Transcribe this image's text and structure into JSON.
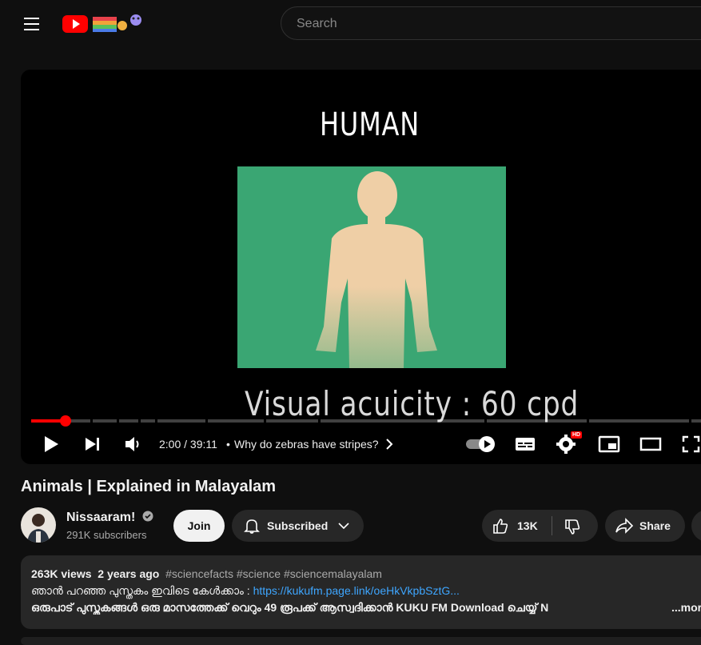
{
  "search": {
    "placeholder": "Search"
  },
  "player": {
    "frame_title": "HUMAN",
    "frame_caption": "Visual acuicity : 60 cpd",
    "time": "2:00 / 39:11",
    "chapter": "Why do zebras have stripes?",
    "progress_fraction": 0.051,
    "hd_badge": "HD"
  },
  "video": {
    "title": "Animals | Explained in Malayalam"
  },
  "owner": {
    "channel_name": "Nissaaram!",
    "subscribers": "291K subscribers",
    "join_label": "Join",
    "subscribed_label": "Subscribed"
  },
  "actions": {
    "like_count": "13K",
    "share_label": "Share"
  },
  "description": {
    "views": "263K views",
    "age": "2 years ago",
    "tags": "#sciencefacts #science #sciencemalayalam",
    "line1_text": "ഞാൻ പറഞ്ഞ പുസ്തകം ഇവിടെ കേൾക്കാം : ",
    "line1_link": "https://kukufm.page.link/oeHkVkpbSztG...",
    "line2_text": " ഒരുപാട് പുസ്തകങ്ങൾ ഒരു മാസത്തേക്ക് വെറും 49 രൂപക്ക് ആസ്വദിക്കാൻ KUKU FM Download ചെയ്യ്  N",
    "more_label": "...more"
  },
  "colors": {
    "accent": "#ff0000",
    "background": "#0f0f0f",
    "link": "#3ea6ff",
    "video_bg": "#3aa673"
  }
}
